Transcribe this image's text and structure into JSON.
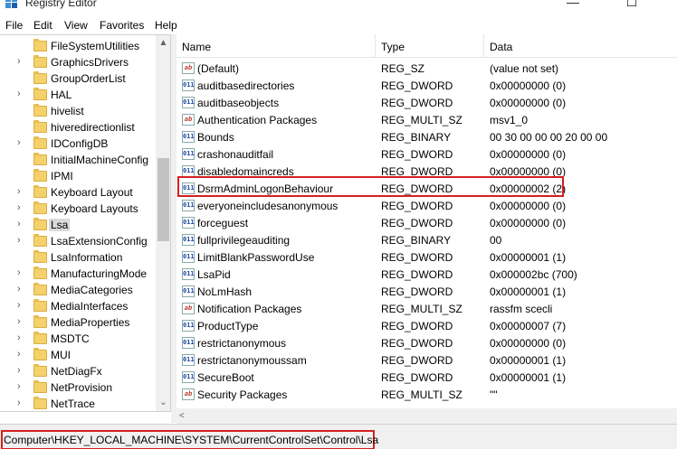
{
  "window": {
    "title": "Registry Editor",
    "minimize_glyph": "—",
    "maximize_glyph": "☐",
    "close_glyph": "✕"
  },
  "menu": [
    "File",
    "Edit",
    "View",
    "Favorites",
    "Help"
  ],
  "tree": {
    "expand_glyph": "›",
    "items": [
      {
        "label": "FileSystemUtilities",
        "expandable": false
      },
      {
        "label": "GraphicsDrivers",
        "expandable": true
      },
      {
        "label": "GroupOrderList",
        "expandable": false
      },
      {
        "label": "HAL",
        "expandable": true
      },
      {
        "label": "hivelist",
        "expandable": false
      },
      {
        "label": "hiveredirectionlist",
        "expandable": false
      },
      {
        "label": "IDConfigDB",
        "expandable": true
      },
      {
        "label": "InitialMachineConfig",
        "expandable": false
      },
      {
        "label": "IPMI",
        "expandable": false
      },
      {
        "label": "Keyboard Layout",
        "expandable": true
      },
      {
        "label": "Keyboard Layouts",
        "expandable": true
      },
      {
        "label": "Lsa",
        "expandable": true,
        "selected": true
      },
      {
        "label": "LsaExtensionConfig",
        "expandable": true
      },
      {
        "label": "LsaInformation",
        "expandable": false
      },
      {
        "label": "ManufacturingMode",
        "expandable": true
      },
      {
        "label": "MediaCategories",
        "expandable": true
      },
      {
        "label": "MediaInterfaces",
        "expandable": true
      },
      {
        "label": "MediaProperties",
        "expandable": true
      },
      {
        "label": "MSDTC",
        "expandable": true
      },
      {
        "label": "MUI",
        "expandable": true
      },
      {
        "label": "NetDiagFx",
        "expandable": true
      },
      {
        "label": "NetProvision",
        "expandable": true
      },
      {
        "label": "NetTrace",
        "expandable": true
      }
    ]
  },
  "columns": {
    "name": "Name",
    "type": "Type",
    "data": "Data"
  },
  "values": [
    {
      "name": "(Default)",
      "type": "REG_SZ",
      "data": "(value not set)",
      "icon": "ab"
    },
    {
      "name": "auditbasedirectories",
      "type": "REG_DWORD",
      "data": "0x00000000 (0)",
      "icon": "bin"
    },
    {
      "name": "auditbaseobjects",
      "type": "REG_DWORD",
      "data": "0x00000000 (0)",
      "icon": "bin"
    },
    {
      "name": "Authentication Packages",
      "type": "REG_MULTI_SZ",
      "data": "msv1_0",
      "icon": "ab"
    },
    {
      "name": "Bounds",
      "type": "REG_BINARY",
      "data": "00 30 00 00 00 20 00 00",
      "icon": "bin"
    },
    {
      "name": "crashonauditfail",
      "type": "REG_DWORD",
      "data": "0x00000000 (0)",
      "icon": "bin"
    },
    {
      "name": "disabledomaincreds",
      "type": "REG_DWORD",
      "data": "0x00000000 (0)",
      "icon": "bin"
    },
    {
      "name": "DsrmAdminLogonBehaviour",
      "type": "REG_DWORD",
      "data": "0x00000002 (2)",
      "icon": "bin",
      "highlighted": true
    },
    {
      "name": "everyoneincludesanonymous",
      "type": "REG_DWORD",
      "data": "0x00000000 (0)",
      "icon": "bin"
    },
    {
      "name": "forceguest",
      "type": "REG_DWORD",
      "data": "0x00000000 (0)",
      "icon": "bin"
    },
    {
      "name": "fullprivilegeauditing",
      "type": "REG_BINARY",
      "data": "00",
      "icon": "bin"
    },
    {
      "name": "LimitBlankPasswordUse",
      "type": "REG_DWORD",
      "data": "0x00000001 (1)",
      "icon": "bin"
    },
    {
      "name": "LsaPid",
      "type": "REG_DWORD",
      "data": "0x000002bc (700)",
      "icon": "bin"
    },
    {
      "name": "NoLmHash",
      "type": "REG_DWORD",
      "data": "0x00000001 (1)",
      "icon": "bin"
    },
    {
      "name": "Notification Packages",
      "type": "REG_MULTI_SZ",
      "data": "rassfm scecli",
      "icon": "ab"
    },
    {
      "name": "ProductType",
      "type": "REG_DWORD",
      "data": "0x00000007 (7)",
      "icon": "bin"
    },
    {
      "name": "restrictanonymous",
      "type": "REG_DWORD",
      "data": "0x00000000 (0)",
      "icon": "bin"
    },
    {
      "name": "restrictanonymoussam",
      "type": "REG_DWORD",
      "data": "0x00000001 (1)",
      "icon": "bin"
    },
    {
      "name": "SecureBoot",
      "type": "REG_DWORD",
      "data": "0x00000001 (1)",
      "icon": "bin"
    },
    {
      "name": "Security Packages",
      "type": "REG_MULTI_SZ",
      "data": "\"\"",
      "icon": "ab"
    }
  ],
  "icon_glyphs": {
    "ab": "ab",
    "bin": "011"
  },
  "scroll_glyphs": {
    "up": "▲",
    "down": "⌄",
    "left": "<"
  },
  "status": {
    "path": "Computer\\HKEY_LOCAL_MACHINE\\SYSTEM\\CurrentControlSet\\Control\\Lsa"
  },
  "colors": {
    "highlight_border": "#d42020",
    "folder": "#f4d16b"
  }
}
